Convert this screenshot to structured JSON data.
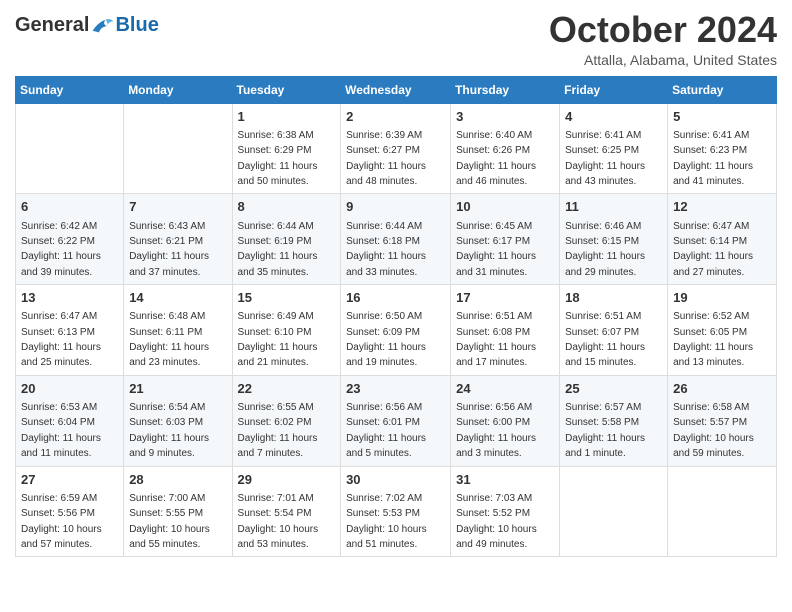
{
  "header": {
    "logo_general": "General",
    "logo_blue": "Blue",
    "title": "October 2024",
    "location": "Attalla, Alabama, United States"
  },
  "weekdays": [
    "Sunday",
    "Monday",
    "Tuesday",
    "Wednesday",
    "Thursday",
    "Friday",
    "Saturday"
  ],
  "weeks": [
    [
      {
        "day": "",
        "info": ""
      },
      {
        "day": "",
        "info": ""
      },
      {
        "day": "1",
        "info": "Sunrise: 6:38 AM\nSunset: 6:29 PM\nDaylight: 11 hours and 50 minutes."
      },
      {
        "day": "2",
        "info": "Sunrise: 6:39 AM\nSunset: 6:27 PM\nDaylight: 11 hours and 48 minutes."
      },
      {
        "day": "3",
        "info": "Sunrise: 6:40 AM\nSunset: 6:26 PM\nDaylight: 11 hours and 46 minutes."
      },
      {
        "day": "4",
        "info": "Sunrise: 6:41 AM\nSunset: 6:25 PM\nDaylight: 11 hours and 43 minutes."
      },
      {
        "day": "5",
        "info": "Sunrise: 6:41 AM\nSunset: 6:23 PM\nDaylight: 11 hours and 41 minutes."
      }
    ],
    [
      {
        "day": "6",
        "info": "Sunrise: 6:42 AM\nSunset: 6:22 PM\nDaylight: 11 hours and 39 minutes."
      },
      {
        "day": "7",
        "info": "Sunrise: 6:43 AM\nSunset: 6:21 PM\nDaylight: 11 hours and 37 minutes."
      },
      {
        "day": "8",
        "info": "Sunrise: 6:44 AM\nSunset: 6:19 PM\nDaylight: 11 hours and 35 minutes."
      },
      {
        "day": "9",
        "info": "Sunrise: 6:44 AM\nSunset: 6:18 PM\nDaylight: 11 hours and 33 minutes."
      },
      {
        "day": "10",
        "info": "Sunrise: 6:45 AM\nSunset: 6:17 PM\nDaylight: 11 hours and 31 minutes."
      },
      {
        "day": "11",
        "info": "Sunrise: 6:46 AM\nSunset: 6:15 PM\nDaylight: 11 hours and 29 minutes."
      },
      {
        "day": "12",
        "info": "Sunrise: 6:47 AM\nSunset: 6:14 PM\nDaylight: 11 hours and 27 minutes."
      }
    ],
    [
      {
        "day": "13",
        "info": "Sunrise: 6:47 AM\nSunset: 6:13 PM\nDaylight: 11 hours and 25 minutes."
      },
      {
        "day": "14",
        "info": "Sunrise: 6:48 AM\nSunset: 6:11 PM\nDaylight: 11 hours and 23 minutes."
      },
      {
        "day": "15",
        "info": "Sunrise: 6:49 AM\nSunset: 6:10 PM\nDaylight: 11 hours and 21 minutes."
      },
      {
        "day": "16",
        "info": "Sunrise: 6:50 AM\nSunset: 6:09 PM\nDaylight: 11 hours and 19 minutes."
      },
      {
        "day": "17",
        "info": "Sunrise: 6:51 AM\nSunset: 6:08 PM\nDaylight: 11 hours and 17 minutes."
      },
      {
        "day": "18",
        "info": "Sunrise: 6:51 AM\nSunset: 6:07 PM\nDaylight: 11 hours and 15 minutes."
      },
      {
        "day": "19",
        "info": "Sunrise: 6:52 AM\nSunset: 6:05 PM\nDaylight: 11 hours and 13 minutes."
      }
    ],
    [
      {
        "day": "20",
        "info": "Sunrise: 6:53 AM\nSunset: 6:04 PM\nDaylight: 11 hours and 11 minutes."
      },
      {
        "day": "21",
        "info": "Sunrise: 6:54 AM\nSunset: 6:03 PM\nDaylight: 11 hours and 9 minutes."
      },
      {
        "day": "22",
        "info": "Sunrise: 6:55 AM\nSunset: 6:02 PM\nDaylight: 11 hours and 7 minutes."
      },
      {
        "day": "23",
        "info": "Sunrise: 6:56 AM\nSunset: 6:01 PM\nDaylight: 11 hours and 5 minutes."
      },
      {
        "day": "24",
        "info": "Sunrise: 6:56 AM\nSunset: 6:00 PM\nDaylight: 11 hours and 3 minutes."
      },
      {
        "day": "25",
        "info": "Sunrise: 6:57 AM\nSunset: 5:58 PM\nDaylight: 11 hours and 1 minute."
      },
      {
        "day": "26",
        "info": "Sunrise: 6:58 AM\nSunset: 5:57 PM\nDaylight: 10 hours and 59 minutes."
      }
    ],
    [
      {
        "day": "27",
        "info": "Sunrise: 6:59 AM\nSunset: 5:56 PM\nDaylight: 10 hours and 57 minutes."
      },
      {
        "day": "28",
        "info": "Sunrise: 7:00 AM\nSunset: 5:55 PM\nDaylight: 10 hours and 55 minutes."
      },
      {
        "day": "29",
        "info": "Sunrise: 7:01 AM\nSunset: 5:54 PM\nDaylight: 10 hours and 53 minutes."
      },
      {
        "day": "30",
        "info": "Sunrise: 7:02 AM\nSunset: 5:53 PM\nDaylight: 10 hours and 51 minutes."
      },
      {
        "day": "31",
        "info": "Sunrise: 7:03 AM\nSunset: 5:52 PM\nDaylight: 10 hours and 49 minutes."
      },
      {
        "day": "",
        "info": ""
      },
      {
        "day": "",
        "info": ""
      }
    ]
  ]
}
